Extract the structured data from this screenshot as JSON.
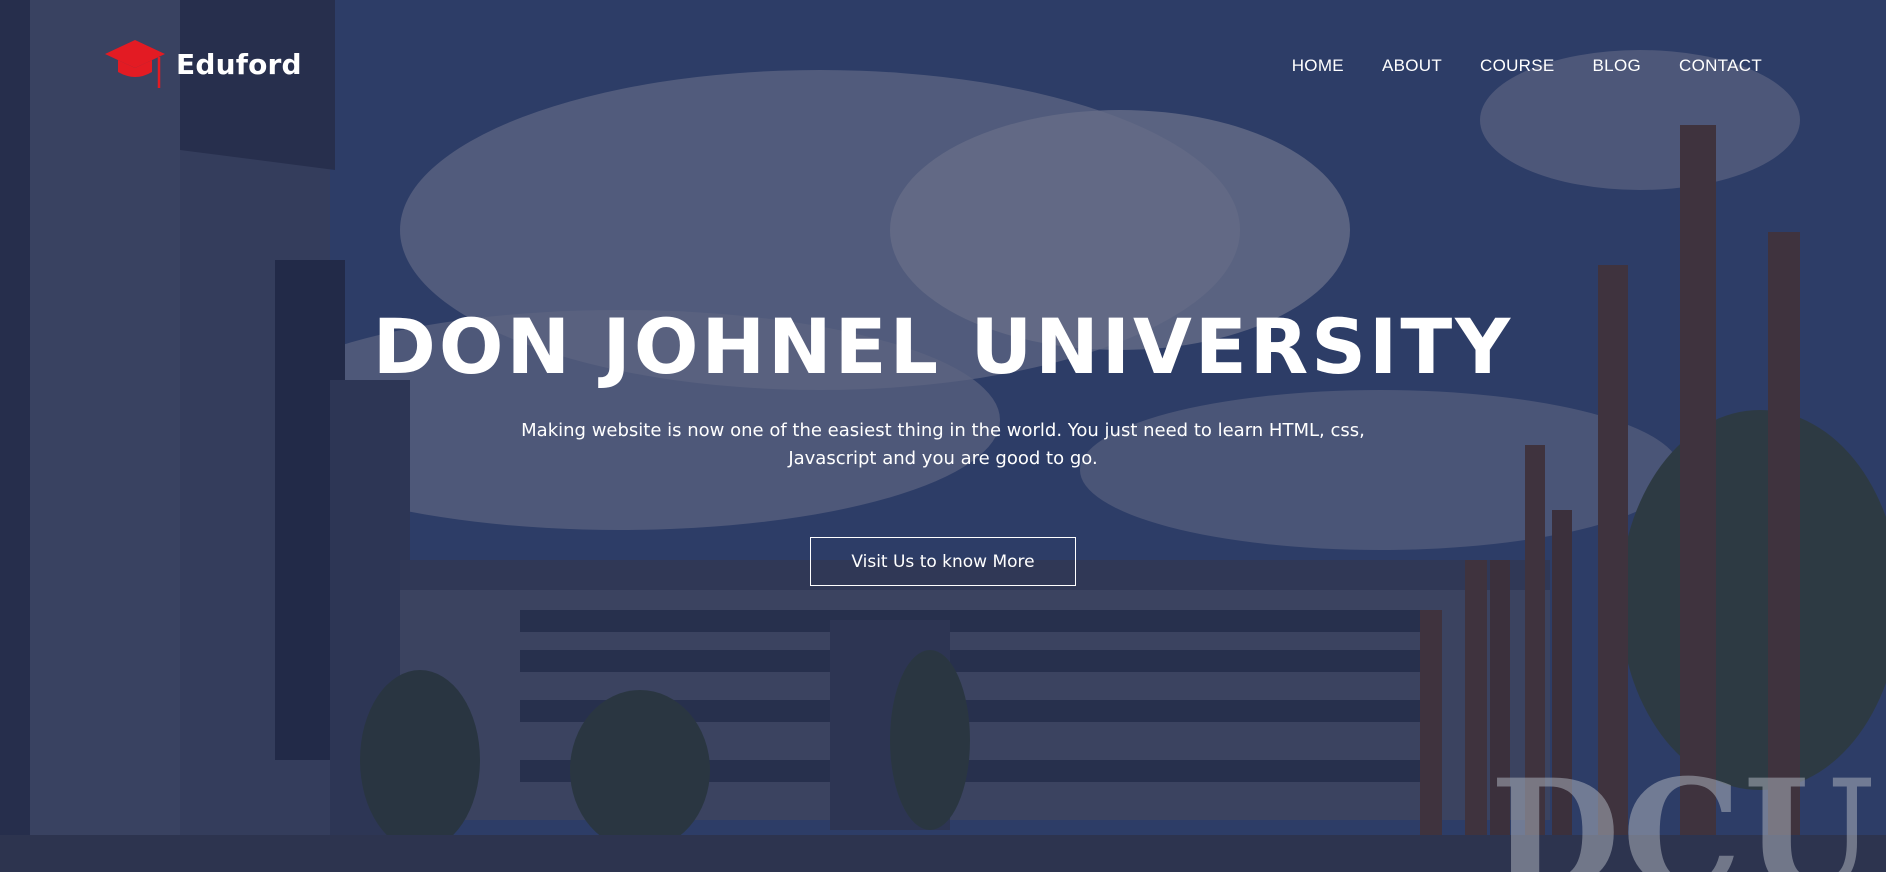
{
  "header": {
    "logo_text": "Eduford",
    "logo_icon": "graduation-cap-icon",
    "logo_color": "#e31b23"
  },
  "nav": {
    "items": [
      {
        "label": "HOME"
      },
      {
        "label": "ABOUT"
      },
      {
        "label": "COURSE"
      },
      {
        "label": "BLOG"
      },
      {
        "label": "CONTACT"
      }
    ]
  },
  "hero": {
    "title": "DON JOHNEL UNIVERSITY",
    "subtitle_line1": "Making website is now one of the easiest thing in the world. You just need to learn HTML, css,",
    "subtitle_line2": "Javascript and you are good to go.",
    "cta_label": "Visit Us to know More",
    "background_overlay_color": "#1b244a",
    "background_sign_text": "DCU"
  }
}
